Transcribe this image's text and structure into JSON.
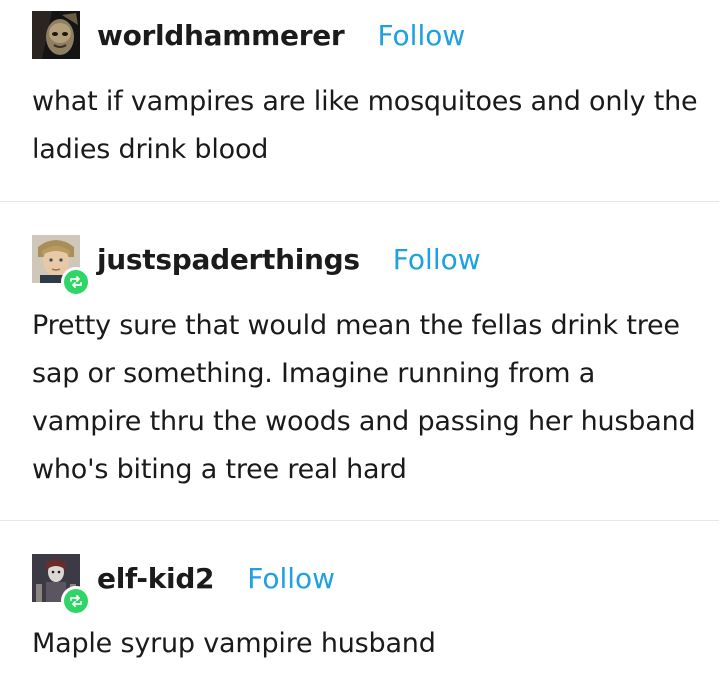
{
  "posts": [
    {
      "username": "worldhammerer",
      "follow_label": "Follow",
      "text": "what if vampires are like mosquitoes and only the ladies drink blood",
      "reblogged": false
    },
    {
      "username": "justspaderthings",
      "follow_label": "Follow",
      "text": "Pretty sure that would mean the fellas drink tree sap or something. Imagine running from a vampire thru the woods and passing her husband who's biting a tree real hard",
      "reblogged": true
    },
    {
      "username": "elf-kid2",
      "follow_label": "Follow",
      "text": "Maple syrup vampire husband",
      "reblogged": true
    }
  ],
  "colors": {
    "follow": "#1da1e0",
    "reblog_badge": "#2fd566",
    "text": "#1a1a1a",
    "divider": "#e6e6e6"
  },
  "icons": {
    "reblog": "reblog-icon",
    "avatar": "avatar-image"
  }
}
